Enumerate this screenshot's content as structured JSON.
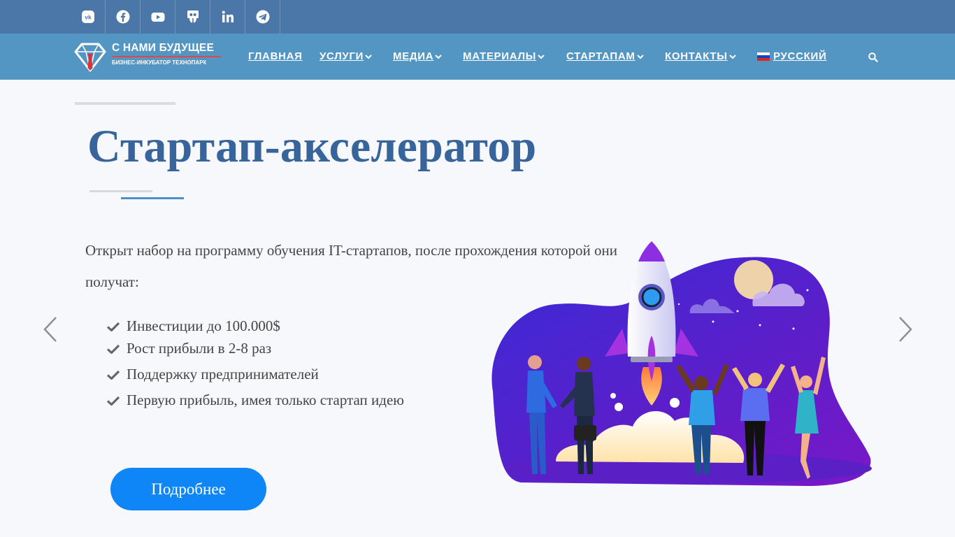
{
  "social": {
    "icons": [
      "vk-icon",
      "facebook-icon",
      "youtube-icon",
      "slideshare-icon",
      "linkedin-icon",
      "telegram-icon"
    ]
  },
  "logo": {
    "title": "С НАМИ БУДУЩЕЕ",
    "subtitle": "БИЗНЕС-ИНКУБАТОР ТЕХНОПАРК"
  },
  "nav": {
    "home": "ГЛАВНАЯ",
    "services": "УСЛУГИ",
    "media": "МЕДИА",
    "materials": "МАТЕРИАЛЫ",
    "startups": "СТАРТАПАМ",
    "contacts": "КОНТАКТЫ",
    "language": "РУССКИЙ"
  },
  "hero": {
    "title": "Стартап-акселератор",
    "intro": "Открыт набор на программу обучения IT-стартапов, после прохождения которой они получат:",
    "features": [
      "Инвестиции до 100.000$",
      "Рост прибыли в 2-8 раз",
      "Поддержку предпринимателей",
      "Первую прибыль, имея только стартап идею"
    ],
    "cta": "Подробнее"
  },
  "colors": {
    "topbar": "#4a77a8",
    "navbar": "#5496c3",
    "title": "#37649a",
    "button": "#0f86f5",
    "accent_red": "#e2483f",
    "illustration_purple": "#5a1fd1"
  }
}
